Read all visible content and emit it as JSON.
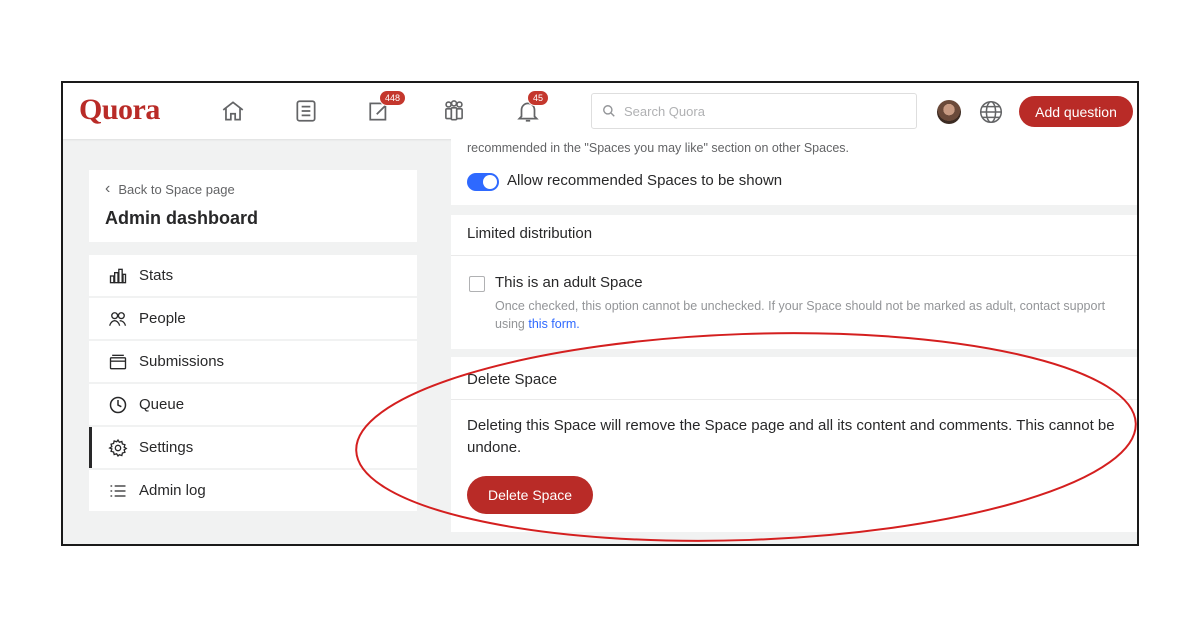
{
  "header": {
    "logo": "Quora",
    "answer_badge": "448",
    "notifications_badge": "45",
    "search_placeholder": "Search Quora",
    "add_question_label": "Add question"
  },
  "sidebar": {
    "back_label": "Back to Space page",
    "title": "Admin dashboard",
    "items": [
      {
        "label": "Stats",
        "icon": "stats-icon"
      },
      {
        "label": "People",
        "icon": "people-icon"
      },
      {
        "label": "Submissions",
        "icon": "submissions-icon"
      },
      {
        "label": "Queue",
        "icon": "clock-icon"
      },
      {
        "label": "Settings",
        "icon": "gear-icon"
      },
      {
        "label": "Admin log",
        "icon": "list-icon"
      }
    ]
  },
  "recommended": {
    "description": "recommended in the \"Spaces you may like\" section on other Spaces.",
    "toggle_label": "Allow recommended Spaces to be shown",
    "toggle_on": true
  },
  "limited_distribution": {
    "header": "Limited distribution",
    "checkbox_label": "This is an adult Space",
    "description": "Once checked, this option cannot be unchecked. If your Space should not be marked as adult, contact support using",
    "link_text": "this form."
  },
  "delete_space": {
    "header": "Delete Space",
    "body": "Deleting this Space will remove the Space page and all its content and comments. This cannot be undone.",
    "button_label": "Delete Space"
  },
  "colors": {
    "brand": "#b92b27",
    "toggle": "#2e69ff",
    "annotation": "#d41f1f"
  }
}
